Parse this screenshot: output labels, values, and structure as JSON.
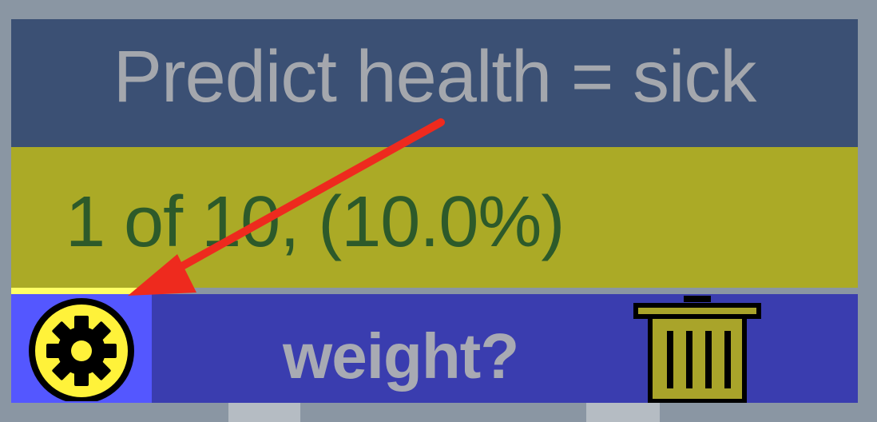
{
  "node": {
    "title": "Predict health = sick",
    "stats": "1 of 10, (10.0%)",
    "split_label": "weight?",
    "coverage_fraction": 0.1
  },
  "icons": {
    "settings": "gear-icon",
    "delete": "trash-icon",
    "annotation": "arrow-annotation"
  },
  "colors": {
    "title_bar": "#3b5074",
    "title_text": "#a4a7ad",
    "stats_bar": "#abaa26",
    "stats_text": "#2d5a2a",
    "split_bar": "#3a3daf",
    "gear_cell": "#5457ff",
    "gear_fill": "#fff23a",
    "trash_fill": "#a9a42a",
    "arrow": "#ee2a1e",
    "background": "#8a96a3"
  }
}
